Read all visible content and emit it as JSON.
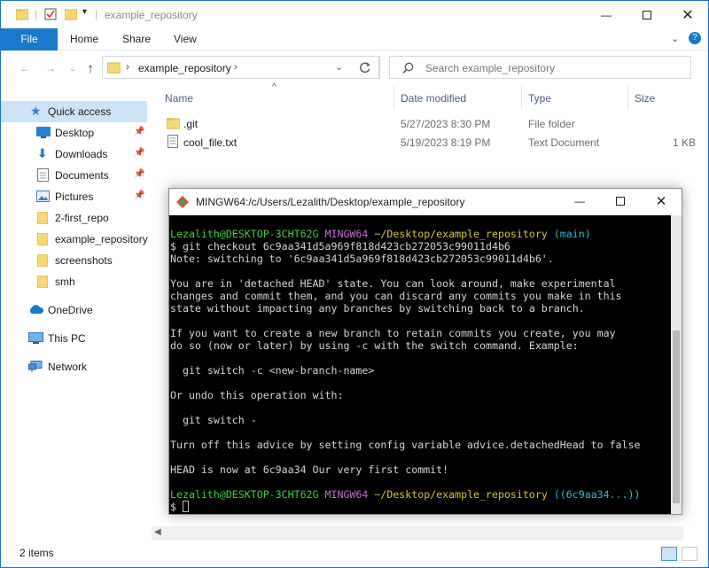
{
  "explorer": {
    "title": "example_repository",
    "ribbon_tabs": [
      "File",
      "Home",
      "Share",
      "View"
    ],
    "address": "example_repository",
    "search_placeholder": "Search example_repository",
    "columns": {
      "name": "Name",
      "date": "Date modified",
      "type": "Type",
      "size": "Size"
    },
    "files": [
      {
        "name": ".git",
        "date": "5/27/2023 8:30 PM",
        "type": "File folder",
        "size": "",
        "icon": "folder-icon"
      },
      {
        "name": "cool_file.txt",
        "date": "5/19/2023 8:19 PM",
        "type": "Text Document",
        "size": "1 KB",
        "icon": "text-file-icon"
      }
    ],
    "sidebar": {
      "quick_access": "Quick access",
      "pinned": [
        "Desktop",
        "Downloads",
        "Documents",
        "Pictures"
      ],
      "folders": [
        "2-first_repo",
        "example_repository",
        "screenshots",
        "smh"
      ],
      "onedrive": "OneDrive",
      "this_pc": "This PC",
      "network": "Network"
    },
    "status": "2 items",
    "accent": "#1979ca"
  },
  "terminal": {
    "title": "MINGW64:/c/Users/Lezalith/Desktop/example_repository",
    "prompt_user": "Lezalith@DESKTOP-3CHT62G",
    "prompt_env": "MINGW64",
    "prompt_path": "~/Desktop/example_repository",
    "prompt_branch_1": "(main)",
    "command": "$ git checkout 6c9aa341d5a969f818d423cb272053c99011d4b6",
    "output_lines": [
      "Note: switching to '6c9aa341d5a969f818d423cb272053c99011d4b6'.",
      "",
      "You are in 'detached HEAD' state. You can look around, make experimental",
      "changes and commit them, and you can discard any commits you make in this",
      "state without impacting any branches by switching back to a branch.",
      "",
      "If you want to create a new branch to retain commits you create, you may",
      "do so (now or later) by using -c with the switch command. Example:",
      "",
      "  git switch -c <new-branch-name>",
      "",
      "Or undo this operation with:",
      "",
      "  git switch -",
      "",
      "Turn off this advice by setting config variable advice.detachedHead to false",
      "",
      "HEAD is now at 6c9aa34 Our very first commit!",
      ""
    ],
    "prompt_branch_2": "((6c9aa34...))",
    "final_prompt": "$ "
  }
}
